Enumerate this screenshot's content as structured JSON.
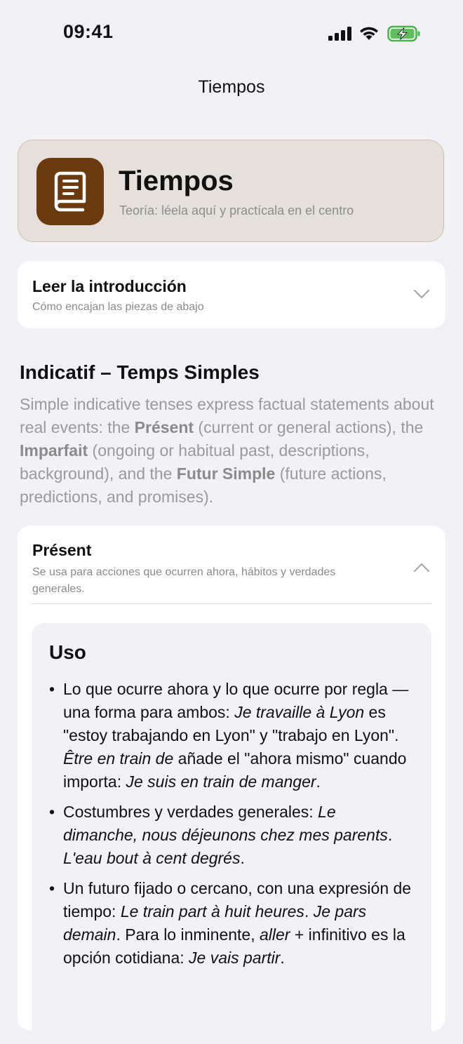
{
  "status": {
    "time": "09:41"
  },
  "nav": {
    "title": "Tiempos"
  },
  "header": {
    "title": "Tiempos",
    "subtitle": "Teoría: léela aquí y practícala en el centro",
    "icon": "book-icon",
    "icon_bg": "#6b3a0e"
  },
  "intro": {
    "title": "Leer la introducción",
    "subtitle": "Cómo encajan las piezas de abajo"
  },
  "section": {
    "title": "Indicatif – Temps Simples",
    "desc_parts": [
      {
        "t": "Simple indicative tenses express factual statements about real events: the "
      },
      {
        "b": "Présent"
      },
      {
        "t": " (current or general actions), the "
      },
      {
        "b": "Imparfait"
      },
      {
        "t": " (ongoing or habitual past, descriptions, background), and the "
      },
      {
        "b": "Futur Simple"
      },
      {
        "t": " (future actions, predictions, and promises)."
      }
    ]
  },
  "present": {
    "title": "Présent",
    "subtitle": "Se usa para acciones que ocurren ahora, hábitos y verdades generales.",
    "uso_title": "Uso",
    "bullet": "•",
    "items": [
      [
        {
          "t": "Lo que ocurre ahora y lo que ocurre por regla — una forma para ambos: "
        },
        {
          "i": "Je travaille à Lyon"
        },
        {
          "t": " es \"estoy trabajando en Lyon\" y \"trabajo en Lyon\". "
        },
        {
          "i": "Être en train de"
        },
        {
          "t": " añade el \"ahora mismo\" cuando importa: "
        },
        {
          "i": "Je suis en train de manger"
        },
        {
          "t": "."
        }
      ],
      [
        {
          "t": "Costumbres y verdades generales: "
        },
        {
          "i": "Le dimanche, nous déjeunons chez mes parents"
        },
        {
          "t": ". "
        },
        {
          "i": "L'eau bout à cent degrés"
        },
        {
          "t": "."
        }
      ],
      [
        {
          "t": "Un futuro fijado o cercano, con una expresión de tiempo: "
        },
        {
          "i": "Le train part à huit heures"
        },
        {
          "t": ". "
        },
        {
          "i": "Je pars demain"
        },
        {
          "t": ". Para lo inminente, "
        },
        {
          "i": "aller"
        },
        {
          "t": " + infinitivo es la opción cotidiana: "
        },
        {
          "i": "Je vais partir"
        },
        {
          "t": "."
        }
      ]
    ]
  }
}
